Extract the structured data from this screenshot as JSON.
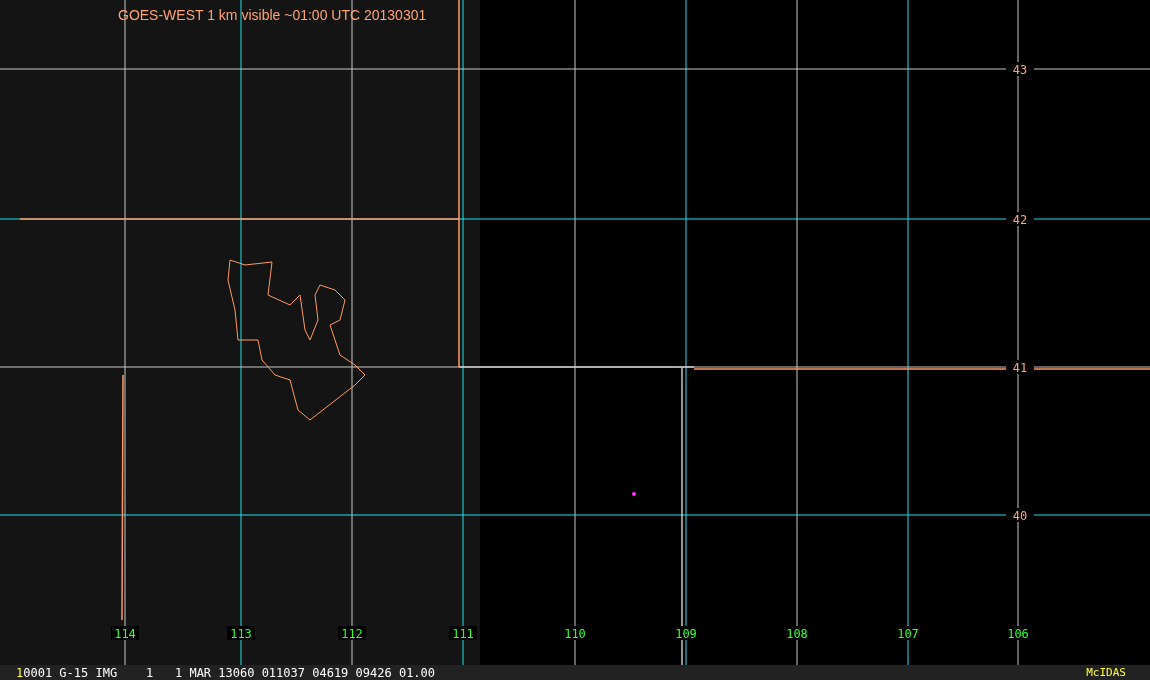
{
  "image_title": "GOES-WEST 1 km visible ~01:00 UTC 20130301",
  "latitude_labels": [
    "43",
    "42",
    "41",
    "40"
  ],
  "longitude_labels": [
    "114",
    "113",
    "112",
    "111",
    "110",
    "109",
    "108",
    "107",
    "106"
  ],
  "status_bar": {
    "frame": "1",
    "fields": "0001 G-15 IMG    1   1 MAR 13060 011037 04619 09426 01.00",
    "brand": "McIDAS"
  }
}
